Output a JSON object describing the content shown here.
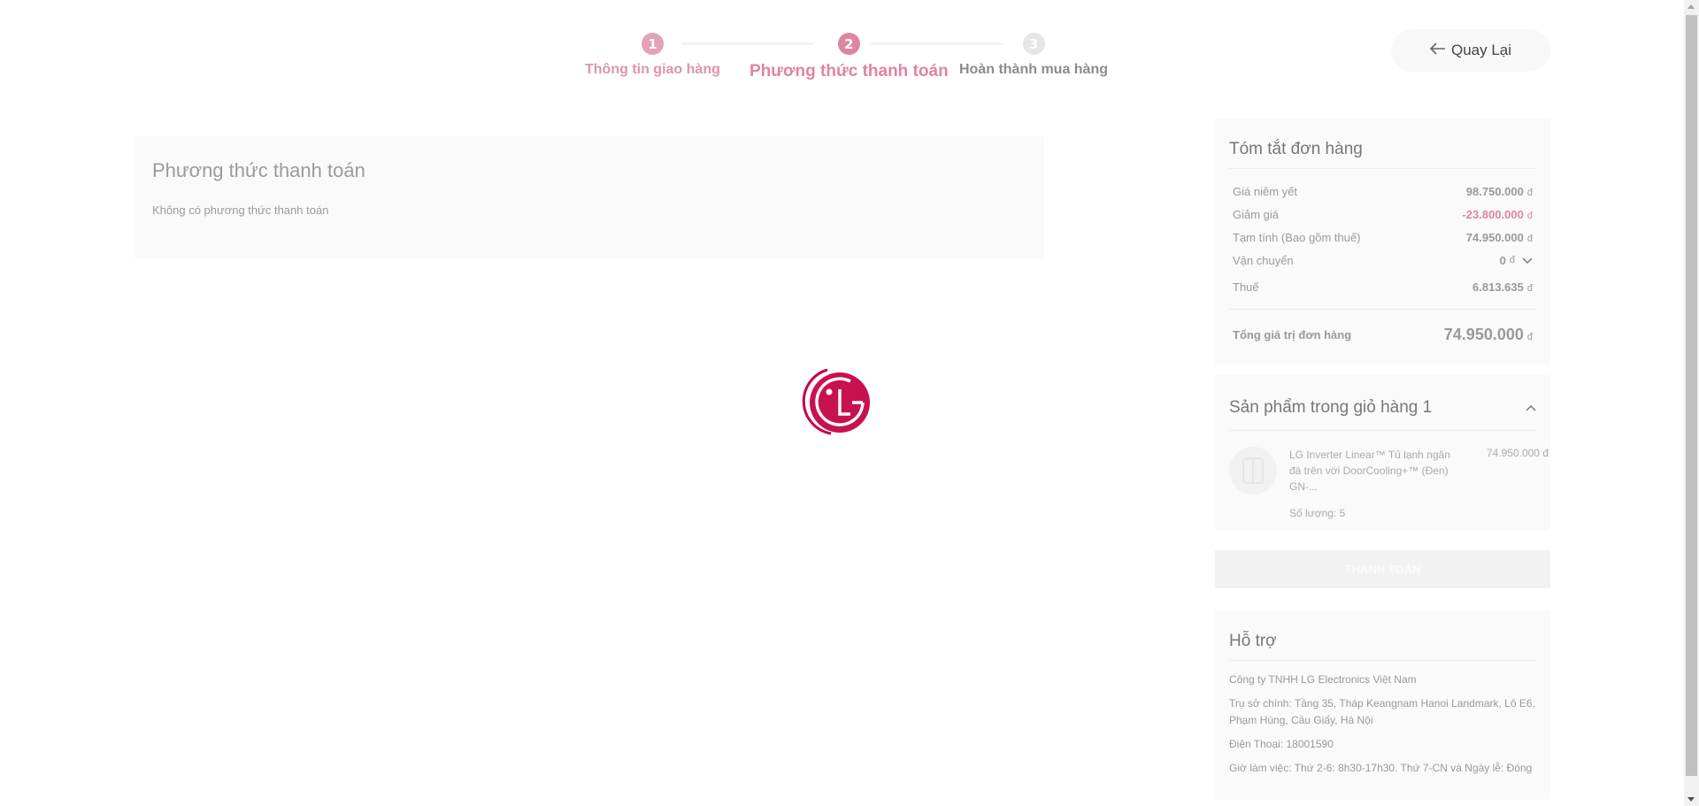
{
  "colors": {
    "accent": "#e0859e",
    "brand": "#c6004b",
    "muted": "#9a9a9a"
  },
  "stepper": {
    "steps": [
      {
        "number": "1",
        "label": "Thông tin giao hàng",
        "state": "done"
      },
      {
        "number": "2",
        "label": "Phương thức thanh toán",
        "state": "active"
      },
      {
        "number": "3",
        "label": "Hoàn thành mua hàng",
        "state": "todo"
      }
    ]
  },
  "back_button": {
    "label": "Quay Lại",
    "icon": "arrow-left-icon"
  },
  "payment": {
    "title": "Phương thức thanh toán",
    "empty_text": "Không có phương thức thanh toán"
  },
  "loading_logo": {
    "icon": "lg-logo-icon"
  },
  "summary": {
    "title": "Tóm tắt đơn hàng",
    "rows": [
      {
        "label": "Giá niêm yết",
        "value": "98.750.000",
        "currency": "đ"
      },
      {
        "label": "Giảm giá",
        "value": "-23.800.000",
        "currency": "đ"
      },
      {
        "label": "Tạm tính (Bao gồm thuế)",
        "value": "74.950.000",
        "currency": "đ"
      },
      {
        "label": "Vận chuyển",
        "value": "0",
        "currency": "đ"
      },
      {
        "label": "Thuế",
        "value": "6.813.635",
        "currency": "đ"
      }
    ],
    "total": {
      "label": "Tổng giá trị đơn hàng",
      "value": "74.950.000",
      "currency": "đ"
    }
  },
  "cart": {
    "title": "Sản phẩm trong giỏ hàng 1",
    "item": {
      "name": "LG Inverter Linear™ Tủ lạnh ngăn đá trên với DoorCooling+™ (Đen) GN-...",
      "quantity": "Số lượng: 5",
      "price": "74.950.000 đ"
    }
  },
  "pay_button": {
    "label": "THANH TOÁN"
  },
  "support": {
    "title": "Hỗ trợ",
    "lines": [
      "Công ty TNHH LG Electronics Việt Nam",
      "Trụ sở chính: Tầng 35, Tháp Keangnam Hanoi Landmark, Lô E6, Phạm Hùng, Cầu Giấy, Hà Nội",
      "Điện Thoại: 18001590",
      "Giờ làm việc: Thứ 2-6: 8h30-17h30. Thứ 7-CN và Ngày lễ: Đóng"
    ]
  }
}
